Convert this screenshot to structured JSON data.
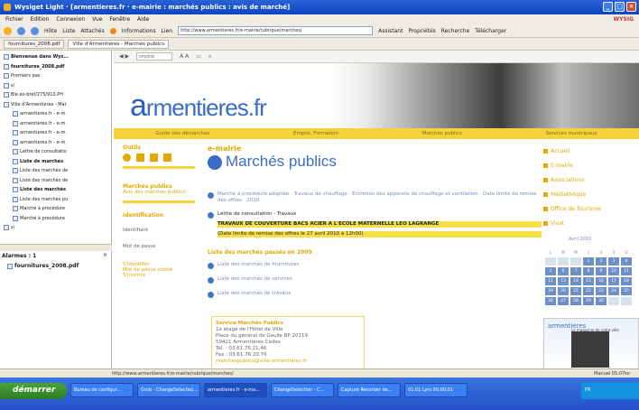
{
  "window": {
    "title": "Wysiget Light · [armentieres.fr · e-mairie : marchés publics : avis de marché]",
    "brand_right": "WYSIG"
  },
  "menu": [
    "Fichier",
    "Edition",
    "Connexion",
    "Vue",
    "Fenêtre",
    "Aide"
  ],
  "toolbar": {
    "host_label": "Hôte",
    "liste_label": "Liste",
    "attaches_label": "Attachés",
    "informations_label": "Informations",
    "url_label": "Lien",
    "url_value": "http://www.armentieres.fr/e-mairie/rubrique/marches/",
    "assistant_label": "Assistant",
    "proprietes_label": "Propriétés",
    "recherche_label": "Recherche",
    "telecharger_label": "Télécharger"
  },
  "tabs": [
    "fournitures_2008.pdf",
    "Ville d'Armentières - Marchés publics"
  ],
  "sidebar": {
    "items": [
      {
        "label": "Bienvenue dans Wys...",
        "bold": true
      },
      {
        "label": "fournitures_2008.pdf",
        "bold": true
      },
      {
        "label": "Premiers pas",
        "bold": false
      },
      {
        "label": "s/",
        "bold": false
      },
      {
        "label": "Ble.ex-bref/275/910.PH",
        "bold": false
      },
      {
        "label": "Ville d'Armentières - Mar",
        "bold": false
      },
      {
        "label": "armentieres.fr - e-m.",
        "bold": false
      },
      {
        "label": "armentieres.fr - e-m.",
        "bold": false
      },
      {
        "label": "armentieres.fr - e-m.",
        "bold": false
      },
      {
        "label": "armentieres.fr - e-m.",
        "bold": false
      },
      {
        "label": "Lettre de consultatio",
        "bold": false
      },
      {
        "label": "Liste de marchés",
        "bold": true
      },
      {
        "label": "Liste des marchés de",
        "bold": false
      },
      {
        "label": "Liste des marchés de",
        "bold": false
      },
      {
        "label": "Liste des marchés",
        "bold": true
      },
      {
        "label": "Liste des marchés pu",
        "bold": false
      },
      {
        "label": "Marché à procédure",
        "bold": false
      },
      {
        "label": "Marché à procédure",
        "bold": false
      },
      {
        "label": "s/",
        "bold": false
      }
    ],
    "alarmes_title": "Alarmes : 1",
    "alarmes_close": "×",
    "alarmes_item": "fournitures_2008.pdf"
  },
  "content_toolbar": {
    "search_placeholder": "emplois",
    "font_labels": "A A"
  },
  "site": {
    "logo_a": "a",
    "logo_rest": "rmentieres.fr",
    "nav": [
      "Guide des démarches",
      "Emploi, Formation",
      "Marchés publics",
      "Services municipaux"
    ],
    "left": {
      "outils_title": "Outils",
      "marches_title": "Marchés publics",
      "marches_link": "Avis des marchés publics",
      "identification_title": "Identification",
      "identifiant_label": "Identifiant",
      "motdepasse_label": "Mot de passe",
      "links": [
        "S'identifier",
        "Mot de passe oublié",
        "S'inscrire"
      ]
    },
    "main": {
      "section": "e-mairie",
      "title": "Marchés publics",
      "entries": [
        {
          "text": "Marché à procédure adaptée · Travaux de chauffage · Entretien des appareils de chauffage et ventilation · Date limite de remise des offres · 2010",
          "hl": false
        },
        {
          "text": "Lettre de consultation - Travaux",
          "hl": false
        },
        {
          "text": "TRAVAUX DE COUVERTURE BACS ACIER A L'ECOLE MATERNELLE LEO LAGRANGE",
          "hl": true
        },
        {
          "text": "(Date limite de remise des offres le 27 avril 2010 à 12h00)",
          "hl": true
        }
      ],
      "list_title": "Liste des marchés passés en 2009",
      "list_items": [
        "Liste des marchés de fournitures",
        "Liste des marchés de services",
        "Liste des marchés de travaux"
      ],
      "contact": {
        "title": "Service Marchés Publics",
        "lines": [
          "1e étage de l'Hôtel de Ville",
          "Place du général de Gaulle BP 20119",
          "59421 Armentières Cedex",
          "Tél. : 03.61.76.21.46",
          "Fax : 03.61.76.20.76"
        ],
        "email": "marchespublics@ville-armentieres.fr"
      }
    },
    "right": {
      "links": [
        "Accueil",
        "E-mairie",
        "Associations",
        "Médiathèque",
        "Office de Tourisme",
        "Vivat"
      ],
      "calendar_title": "Avril 2010",
      "calendar_days": [
        "L",
        "M",
        "M",
        "J",
        "V",
        "S",
        "D"
      ],
      "calendar_dates": [
        "",
        "",
        "",
        "1",
        "2",
        "3",
        "4",
        "5",
        "6",
        "7",
        "8",
        "9",
        "10",
        "11",
        "12",
        "13",
        "14",
        "15",
        "16",
        "17",
        "18",
        "19",
        "20",
        "21",
        "22",
        "23",
        "24",
        "25",
        "26",
        "27",
        "28",
        "29",
        "30",
        "",
        ""
      ],
      "promo_logo": "armentieres",
      "promo_caption": "Le magazine de votre ville"
    }
  },
  "statusbar": {
    "url": "http://www.armentieres.fr/e-mairie/rubrique/marches/",
    "right": "Manuel 05:07ko"
  },
  "taskbar": {
    "start": "démarrer",
    "tasks": [
      "Bureau de configur...",
      "Grub · ChangeSelected...",
      "armentieres.fr · e-ma...",
      "ChangeSelection · C...",
      "Capture Recorder de...",
      "01:01 Lyrs 00:00:01"
    ],
    "clock": "FR"
  }
}
